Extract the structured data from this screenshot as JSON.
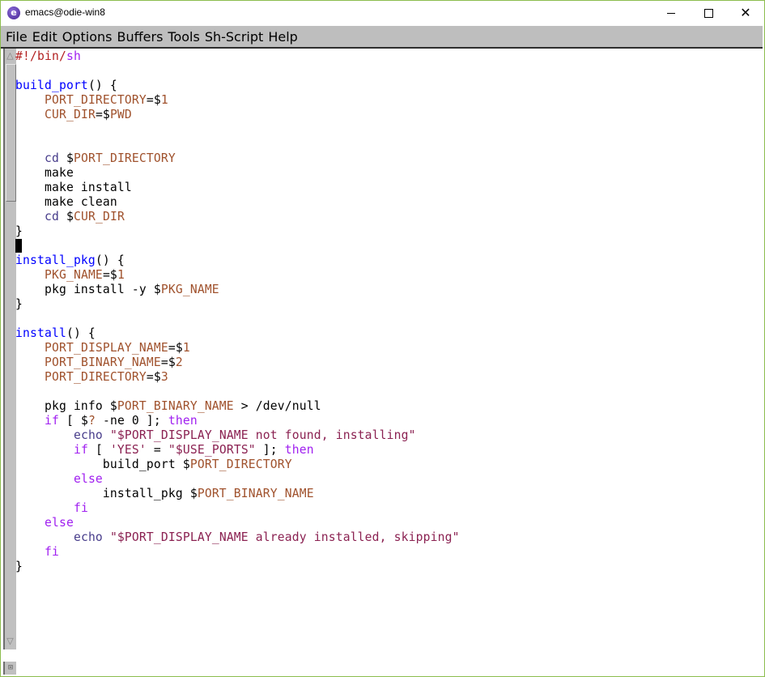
{
  "window": {
    "title": "emacs@odie-win8",
    "icon": "emacs-icon",
    "controls": {
      "minimize": "minimize-icon",
      "maximize": "maximize-icon",
      "close": "close-icon"
    }
  },
  "colors": {
    "comment": "#b22222",
    "shebang": "#a020f0",
    "function": "#0000ff",
    "variable": "#a0522d",
    "builtin": "#483d8b",
    "keyword": "#a020f0",
    "string": "#8b2252",
    "menubar": "#bebebe",
    "window_border": "#8cbd4e"
  },
  "menubar": {
    "items": [
      "File",
      "Edit",
      "Options",
      "Buffers",
      "Tools",
      "Sh-Script",
      "Help"
    ]
  },
  "buffer": {
    "cursor_line": 13,
    "lines": [
      [
        [
          "comment",
          "#!/bin/"
        ],
        [
          "shebang",
          "sh"
        ]
      ],
      [],
      [
        [
          "func",
          "build_port"
        ],
        [
          "plain",
          "() {"
        ]
      ],
      [
        [
          "plain",
          "    "
        ],
        [
          "var",
          "PORT_DIRECTORY"
        ],
        [
          "plain",
          "=$"
        ],
        [
          "var",
          "1"
        ]
      ],
      [
        [
          "plain",
          "    "
        ],
        [
          "var",
          "CUR_DIR"
        ],
        [
          "plain",
          "=$"
        ],
        [
          "var",
          "PWD"
        ]
      ],
      [],
      [],
      [
        [
          "plain",
          "    "
        ],
        [
          "builtin",
          "cd"
        ],
        [
          "plain",
          " $"
        ],
        [
          "var",
          "PORT_DIRECTORY"
        ]
      ],
      [
        [
          "plain",
          "    make"
        ]
      ],
      [
        [
          "plain",
          "    make install"
        ]
      ],
      [
        [
          "plain",
          "    make clean"
        ]
      ],
      [
        [
          "plain",
          "    "
        ],
        [
          "builtin",
          "cd"
        ],
        [
          "plain",
          " $"
        ],
        [
          "var",
          "CUR_DIR"
        ]
      ],
      [
        [
          "plain",
          "}"
        ]
      ],
      [
        [
          "cursor",
          ""
        ]
      ],
      [
        [
          "func",
          "install_pkg"
        ],
        [
          "plain",
          "() {"
        ]
      ],
      [
        [
          "plain",
          "    "
        ],
        [
          "var",
          "PKG_NAME"
        ],
        [
          "plain",
          "=$"
        ],
        [
          "var",
          "1"
        ]
      ],
      [
        [
          "plain",
          "    pkg install -y $"
        ],
        [
          "var",
          "PKG_NAME"
        ]
      ],
      [
        [
          "plain",
          "}"
        ]
      ],
      [],
      [
        [
          "func",
          "install"
        ],
        [
          "plain",
          "() {"
        ]
      ],
      [
        [
          "plain",
          "    "
        ],
        [
          "var",
          "PORT_DISPLAY_NAME"
        ],
        [
          "plain",
          "=$"
        ],
        [
          "var",
          "1"
        ]
      ],
      [
        [
          "plain",
          "    "
        ],
        [
          "var",
          "PORT_BINARY_NAME"
        ],
        [
          "plain",
          "=$"
        ],
        [
          "var",
          "2"
        ]
      ],
      [
        [
          "plain",
          "    "
        ],
        [
          "var",
          "PORT_DIRECTORY"
        ],
        [
          "plain",
          "=$"
        ],
        [
          "var",
          "3"
        ]
      ],
      [],
      [
        [
          "plain",
          "    pkg info $"
        ],
        [
          "var",
          "PORT_BINARY_NAME"
        ],
        [
          "plain",
          " > /dev/null"
        ]
      ],
      [
        [
          "plain",
          "    "
        ],
        [
          "keyword",
          "if"
        ],
        [
          "plain",
          " [ $"
        ],
        [
          "var",
          "?"
        ],
        [
          "plain",
          " -ne 0 ]; "
        ],
        [
          "keyword",
          "then"
        ]
      ],
      [
        [
          "plain",
          "        "
        ],
        [
          "builtin",
          "echo"
        ],
        [
          "plain",
          " "
        ],
        [
          "string",
          "\"$PORT_DISPLAY_NAME not found, installing\""
        ]
      ],
      [
        [
          "plain",
          "        "
        ],
        [
          "keyword",
          "if"
        ],
        [
          "plain",
          " [ "
        ],
        [
          "string",
          "'YES'"
        ],
        [
          "plain",
          " = "
        ],
        [
          "string",
          "\"$USE_PORTS\""
        ],
        [
          "plain",
          " ]; "
        ],
        [
          "keyword",
          "then"
        ]
      ],
      [
        [
          "plain",
          "            build_port $"
        ],
        [
          "var",
          "PORT_DIRECTORY"
        ]
      ],
      [
        [
          "plain",
          "        "
        ],
        [
          "keyword",
          "else"
        ]
      ],
      [
        [
          "plain",
          "            install_pkg $"
        ],
        [
          "var",
          "PORT_BINARY_NAME"
        ]
      ],
      [
        [
          "plain",
          "        "
        ],
        [
          "keyword",
          "fi"
        ]
      ],
      [
        [
          "plain",
          "    "
        ],
        [
          "keyword",
          "else"
        ]
      ],
      [
        [
          "plain",
          "        "
        ],
        [
          "builtin",
          "echo"
        ],
        [
          "plain",
          " "
        ],
        [
          "string",
          "\"$PORT_DISPLAY_NAME already installed, skipping\""
        ]
      ],
      [
        [
          "plain",
          "    "
        ],
        [
          "keyword",
          "fi"
        ]
      ],
      [
        [
          "plain",
          "}"
        ]
      ]
    ]
  },
  "scrollbar": {
    "up_icon": "scroll-up-arrow-icon",
    "down_icon": "scroll-down-arrow-icon",
    "visible_fraction": 0.23,
    "position": 0.0
  }
}
